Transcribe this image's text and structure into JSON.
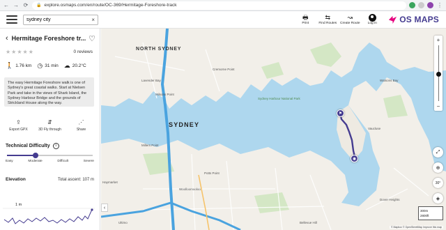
{
  "browser": {
    "url": "explore.osmaps.com/en/route/OC-369/Hermitage-Foreshore-track",
    "back": "←",
    "forward": "→",
    "reload": "⟳"
  },
  "header": {
    "search_value": "sydney city",
    "search_clear": "×",
    "buttons": [
      {
        "label": "Print",
        "icon": "printer-icon",
        "glyph": "🖶"
      },
      {
        "label": "Find Routes",
        "icon": "route-icon",
        "glyph": "⇆"
      },
      {
        "label": "Create Route",
        "icon": "create-route-icon",
        "glyph": "↝"
      },
      {
        "label": "Log in",
        "icon": "user-icon",
        "glyph": ""
      }
    ],
    "logo_text": "OS MAPS",
    "logo_color": "#453c90",
    "logo_accent": "#e6007e"
  },
  "sidebar": {
    "back": "‹",
    "title": "Hermitage Foreshore tr...",
    "heart": "♡",
    "stars": "★★★★★",
    "reviews": "0 reviews",
    "distance": "1.76 km",
    "duration": "31 min",
    "temperature": "20.2°C",
    "description": "The easy Hermitage Foreshore walk is one of Sydney's great coastal walks. Start at Nielsen Park and take in the views of Shark Island, the Sydney Harbour Bridge and the grounds of Strickland House along the way.",
    "actions": [
      {
        "label": "Export GPX",
        "glyph": "⇪"
      },
      {
        "label": "3D Fly through",
        "glyph": "⇵"
      },
      {
        "label": "Share",
        "glyph": "⋰"
      }
    ],
    "tech_difficulty": {
      "label": "Technical Difficulty",
      "info": "i",
      "levels": [
        "Easy",
        "Moderate",
        "Difficult",
        "Severe"
      ],
      "value_fraction": 0.33
    },
    "elevation": {
      "label": "Elevation",
      "ascent": "Total ascent: 107 m",
      "ytick": "1 m"
    }
  },
  "map": {
    "labels": {
      "north_sydney": "NORTH SYDNEY",
      "sydney": "SYDNEY",
      "cremorne": "Cremorne Point",
      "lavender_bay": "Lavender Bay",
      "milsons_point": "Milsons Point",
      "millers_point": "Millers Point",
      "potts_point": "Potts Point",
      "woolloomooloo": "Woolloomooloo",
      "dover_heights": "Dover Heights",
      "bellevue_hill": "Bellevue Hill",
      "vaucluse": "Vaucluse",
      "watsons_bay": "Watsons Bay",
      "sydney_harbour": "Sydney Harbour National Park",
      "ultimo": "Ultimo",
      "haymarket": "Haymarket"
    },
    "zoom_in": "+",
    "zoom_out": "−",
    "zoom_fraction": 0.48,
    "controls": [
      {
        "name": "fullscreen",
        "glyph": "⤢"
      },
      {
        "name": "locate",
        "glyph": "⊕"
      },
      {
        "name": "3d-view",
        "glyph": "30°"
      },
      {
        "name": "layers",
        "glyph": "◈"
      }
    ],
    "scale": [
      "300m",
      "2800ft"
    ],
    "attribution": "© Mapbox © OpenStreetMap Improve this map",
    "collapse": "‹",
    "route_color": "#453c90"
  }
}
